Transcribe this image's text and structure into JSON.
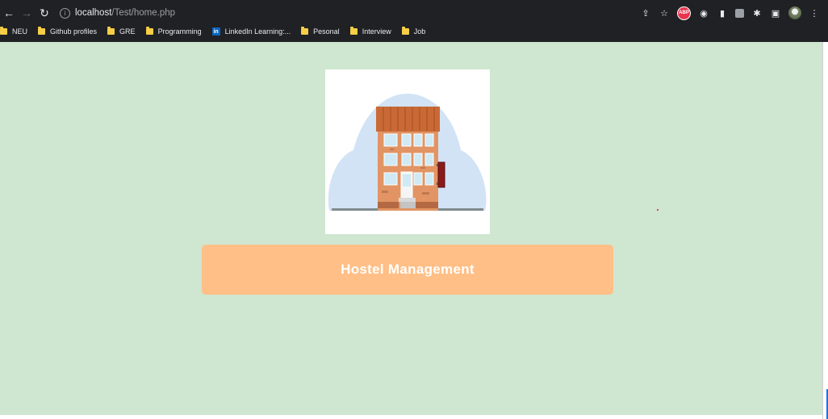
{
  "browser": {
    "url_host": "localhost",
    "url_path": "/Test/home.php",
    "extension_abp": "ABP",
    "bookmarks": [
      {
        "label": "NEU",
        "icon": "folder-icon"
      },
      {
        "label": "Github profiles",
        "icon": "folder-icon"
      },
      {
        "label": "GRE",
        "icon": "folder-icon"
      },
      {
        "label": "Programming",
        "icon": "folder-icon"
      },
      {
        "label": "LinkedIn Learning:...",
        "icon": "linkedin-icon"
      },
      {
        "label": "Pesonal",
        "icon": "folder-icon"
      },
      {
        "label": "Interview",
        "icon": "folder-icon"
      },
      {
        "label": "Job",
        "icon": "folder-icon"
      }
    ]
  },
  "page": {
    "banner_text": "Hostel Management",
    "background_color": "#cfe6d0",
    "banner_color": "#ffbf87",
    "logo": "hostel-building-illustration"
  }
}
